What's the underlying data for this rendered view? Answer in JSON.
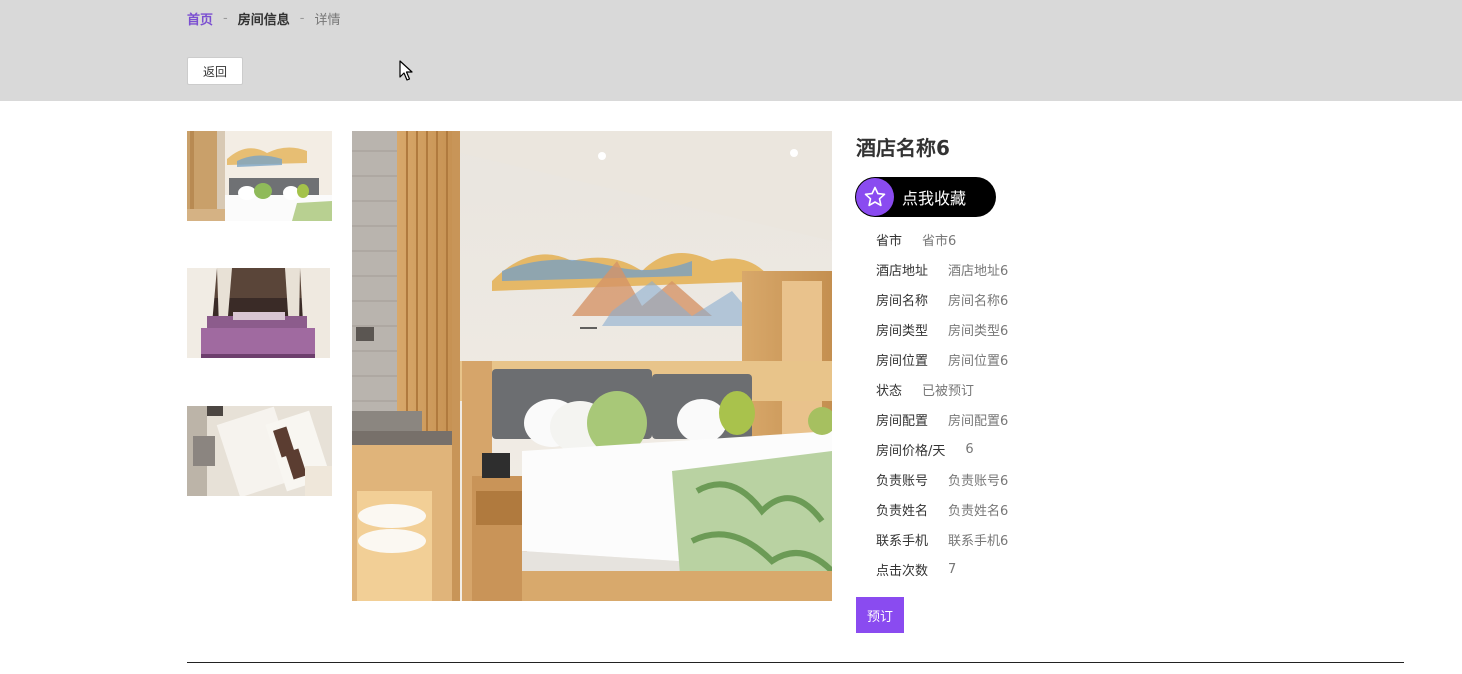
{
  "breadcrumb": {
    "home": "首页",
    "separator": "-",
    "section": "房间信息",
    "current": "详情"
  },
  "back_button": "返回",
  "hotel": {
    "title": "酒店名称6",
    "favorite_label": "点我收藏",
    "book_label": "预订"
  },
  "details": [
    {
      "key": "省市",
      "value": "省市6"
    },
    {
      "key": "酒店地址",
      "value": "酒店地址6"
    },
    {
      "key": "房间名称",
      "value": "房间名称6"
    },
    {
      "key": "房间类型",
      "value": "房间类型6"
    },
    {
      "key": "房间位置",
      "value": "房间位置6"
    },
    {
      "key": "状态",
      "value": "已被预订"
    },
    {
      "key": "房间配置",
      "value": "房间配置6"
    },
    {
      "key": "房间价格/天",
      "value": "6"
    },
    {
      "key": "负责账号",
      "value": "负责账号6"
    },
    {
      "key": "负责姓名",
      "value": "负责姓名6"
    },
    {
      "key": "联系手机",
      "value": "联系手机6"
    },
    {
      "key": "点击次数",
      "value": "7"
    }
  ],
  "colors": {
    "accent": "#8a4bf0",
    "topbar": "#d9d9d9",
    "link": "#7b4fd1"
  },
  "icons": {
    "favorite": "star-icon",
    "cursor": "mouse-cursor-icon"
  }
}
